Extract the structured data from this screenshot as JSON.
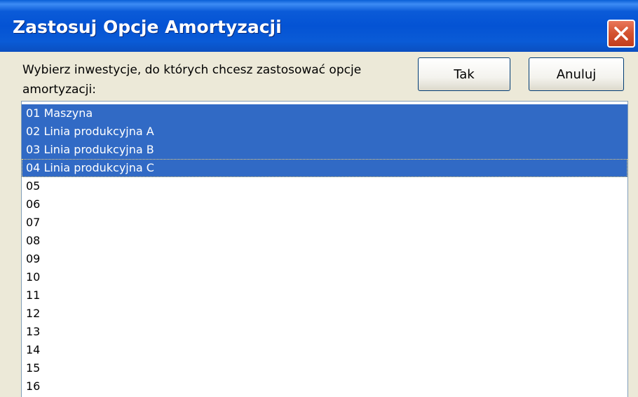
{
  "dialog": {
    "title": "Zastosuj Opcje Amortyzacji",
    "prompt": "Wybierz inwestycje, do których chcesz zastosować opcje amortyzacji:",
    "ok_label": "Tak",
    "cancel_label": "Anuluj"
  },
  "list": {
    "items": [
      {
        "label": "01 Maszyna",
        "selected": true
      },
      {
        "label": "02 Linia produkcyjna A",
        "selected": true
      },
      {
        "label": "03 Linia produkcyjna B",
        "selected": true
      },
      {
        "label": "04 Linia produkcyjna C",
        "selected": true,
        "focused": true
      },
      {
        "label": "05",
        "selected": false
      },
      {
        "label": "06",
        "selected": false
      },
      {
        "label": "07",
        "selected": false
      },
      {
        "label": "08",
        "selected": false
      },
      {
        "label": "09",
        "selected": false
      },
      {
        "label": "10",
        "selected": false
      },
      {
        "label": "11",
        "selected": false
      },
      {
        "label": "12",
        "selected": false
      },
      {
        "label": "13",
        "selected": false
      },
      {
        "label": "14",
        "selected": false
      },
      {
        "label": "15",
        "selected": false
      },
      {
        "label": "16",
        "selected": false
      }
    ]
  },
  "colors": {
    "titlebar": "#0453D4",
    "selection": "#316AC5",
    "dialog_bg": "#ECE9D8",
    "close_button": "#D3522F"
  },
  "icons": {
    "close": "close-icon"
  }
}
